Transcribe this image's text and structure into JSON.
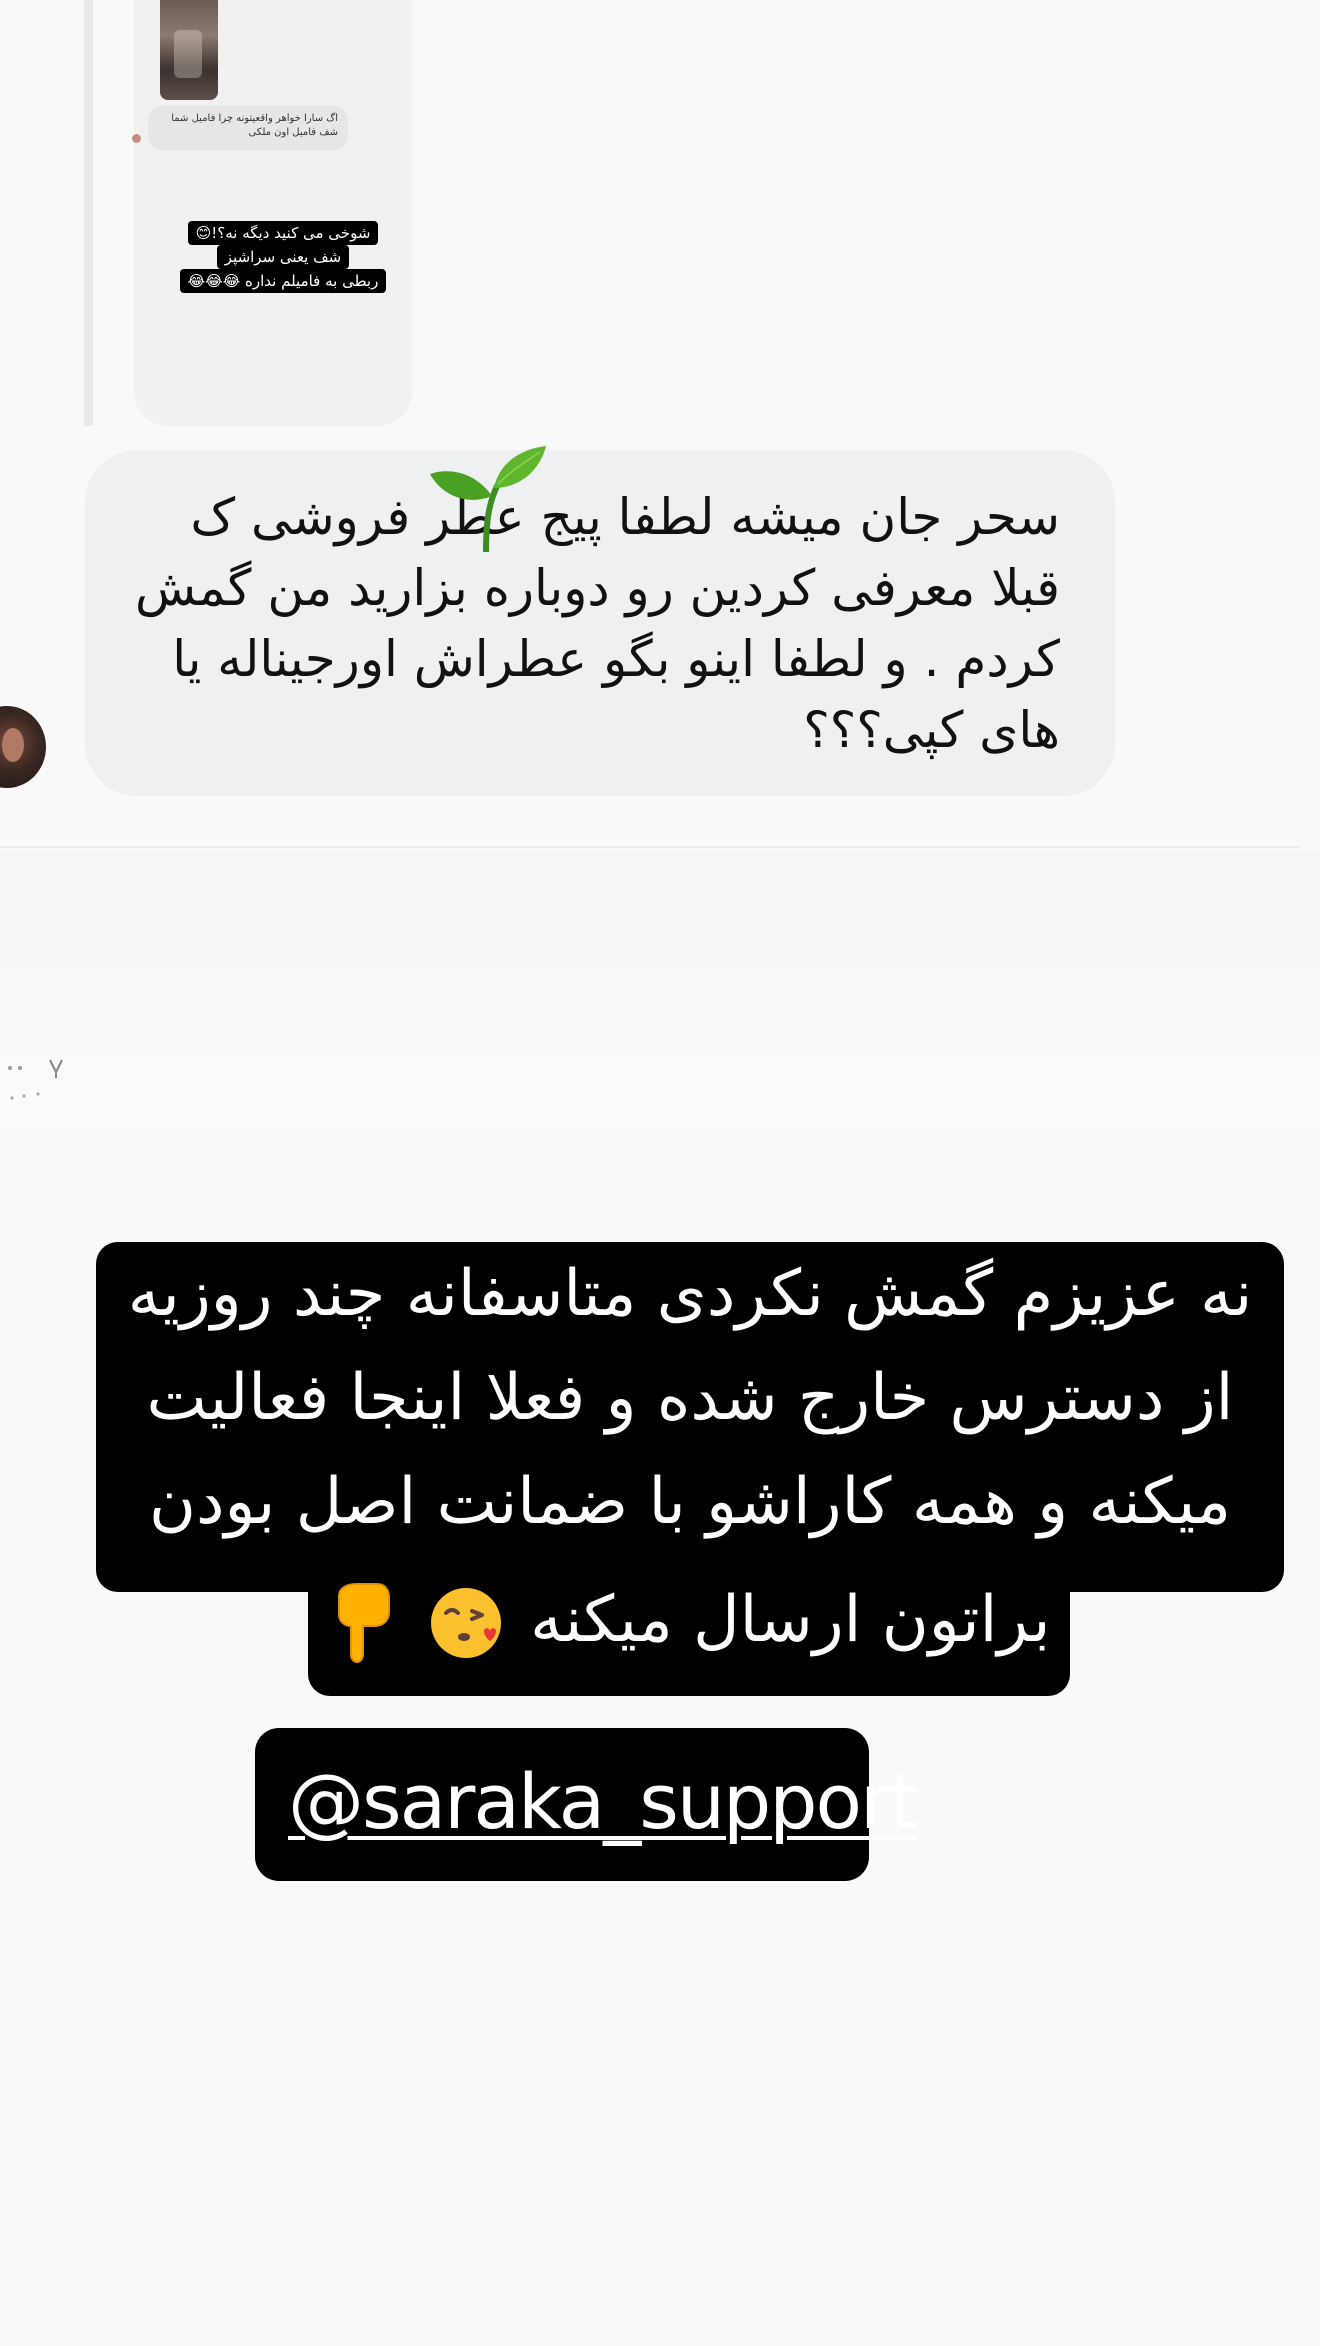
{
  "embedded_reply": {
    "comment_text": "اگ سارا خواهر واقعیتونه چرا فامیل شما شف فامیل اون ملکی",
    "sticker_lines": [
      "شوخی می کنید دیگه نه؟!😊",
      "شف یعنی سراشپز",
      "ربطی به فامیلم نداره 😂😂😂"
    ]
  },
  "comment": {
    "text": "سحر جان میشه لطفا پیج عطر فروشی ک قبلا معرفی کردین رو دوباره بزارید من گمش کردم . و لطفا اینو بگو عطراش اورجیناله یا های کپی؟؟؟",
    "sticker_icon": "sprout-emoji-icon"
  },
  "story_reply": {
    "lines": [
      "نه عزیزم گمش نکردی متاسفانه چند روزیه",
      "از دسترس خارج شده و فعلا اینجا فعالیت",
      "میکنه و همه کاراشو با ضمانت اصل بودن",
      "براتون ارسال میکنه"
    ],
    "emojis": [
      "kissing-face-icon",
      "pointing-down-icon"
    ]
  },
  "mention": {
    "handle": "@saraka_support"
  },
  "colors": {
    "background": "#f9f9f9",
    "bubble": "#eff0f2",
    "sticker_bg": "#000000",
    "sticker_text": "#ffffff"
  }
}
